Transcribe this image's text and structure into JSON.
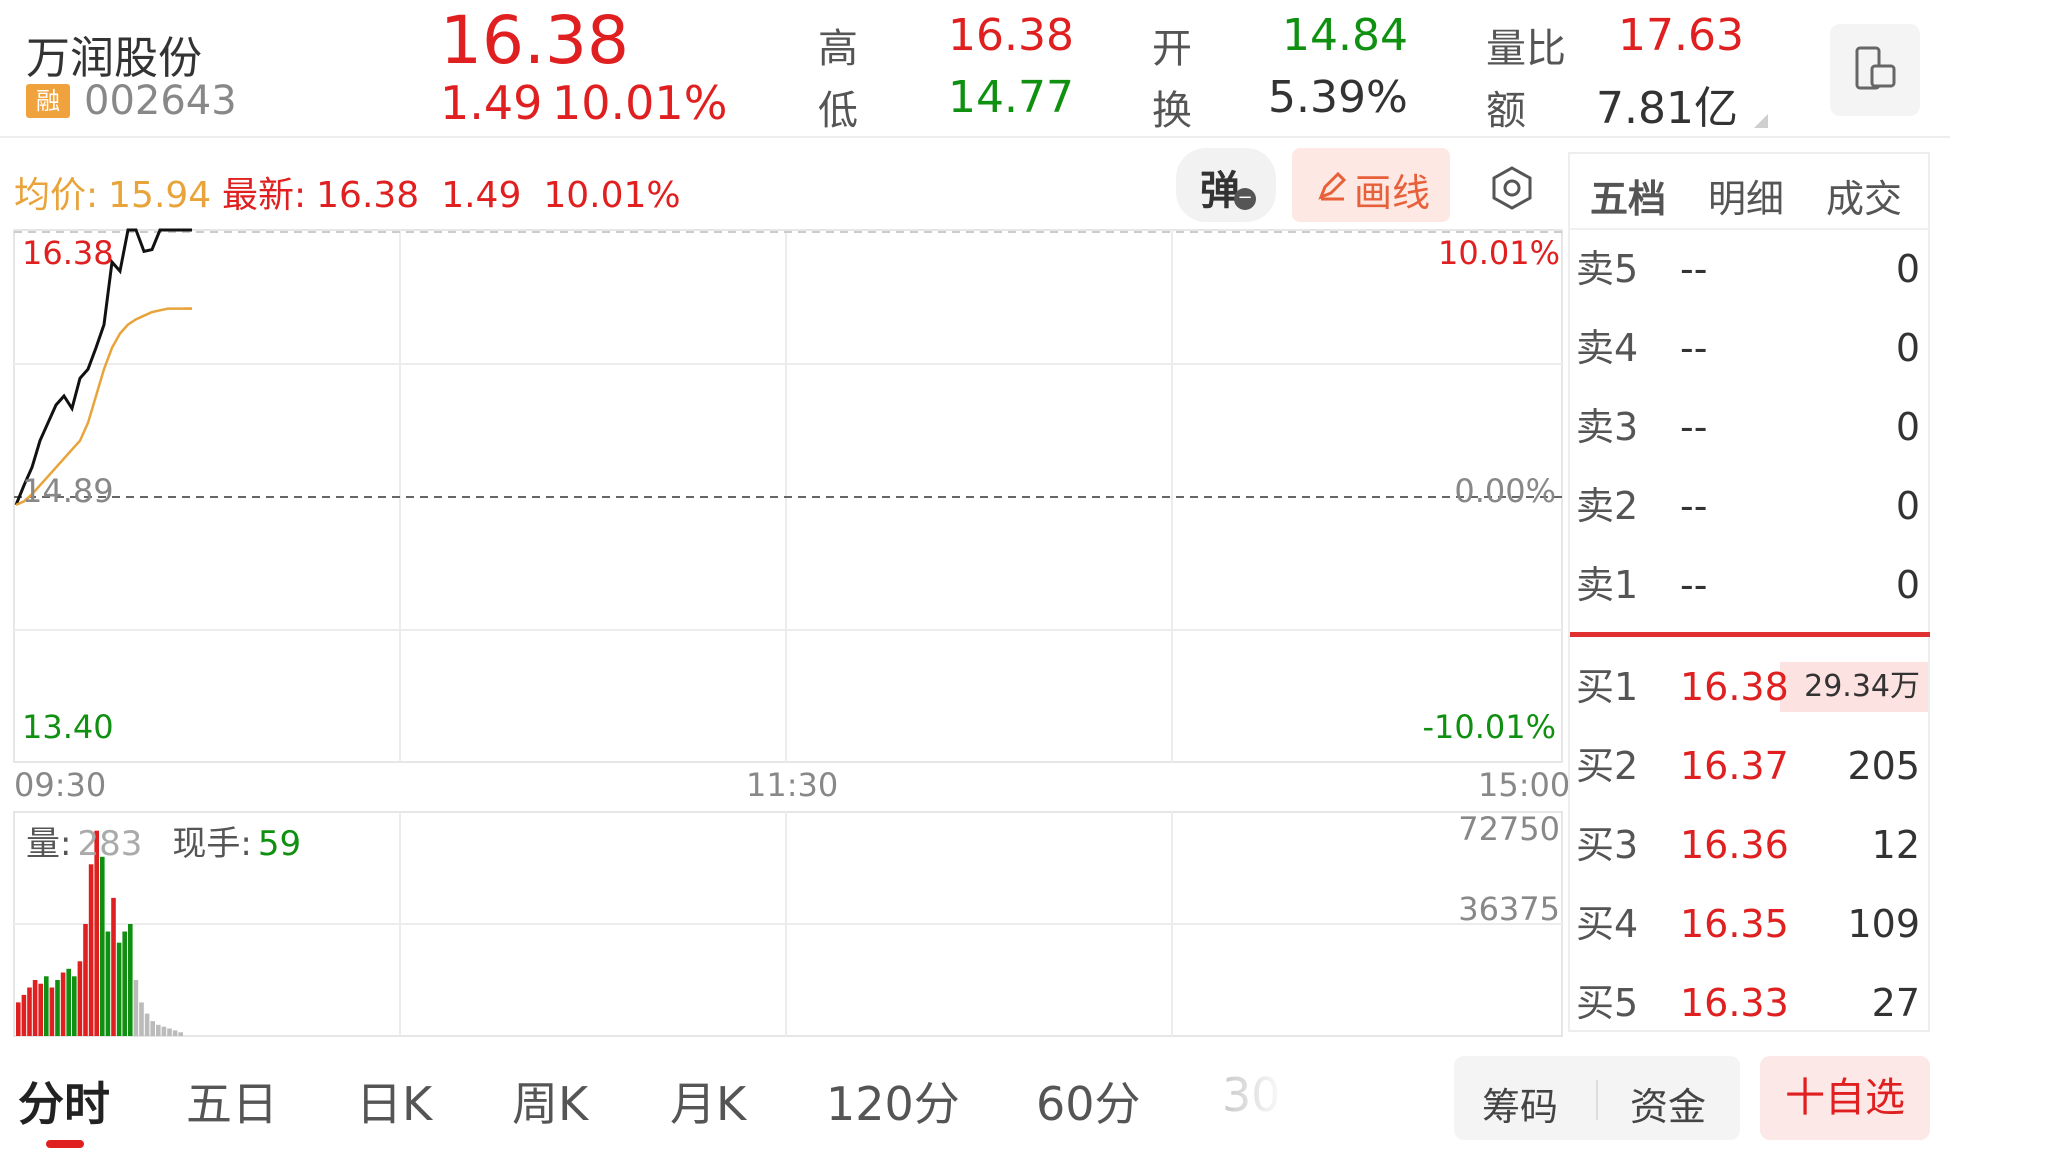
{
  "header": {
    "stock_name": "万润股份",
    "badge": "融",
    "code": "002643",
    "price": "16.38",
    "change": "1.49",
    "change_pct": "10.01%",
    "high_label": "高",
    "high": "16.38",
    "low_label": "低",
    "low": "14.77",
    "open_label": "开",
    "open": "14.84",
    "turnover_label": "换",
    "turnover": "5.39%",
    "vol_ratio_label": "量比",
    "vol_ratio": "17.63",
    "amount_label": "额",
    "amount": "7.81亿",
    "device_icon": "phone-landscape-icon"
  },
  "status_bar": {
    "avg_label": "均价:",
    "avg_value": "15.94",
    "latest_label": "最新:",
    "latest_value": "16.38",
    "latest_change": "1.49",
    "latest_pct": "10.01%",
    "bullet_button": "弹",
    "draw_button": "画线",
    "settings_icon": "gear-icon"
  },
  "chart": {
    "price_top": "16.38",
    "price_mid": "14.89",
    "price_bottom": "13.40",
    "pct_top": "10.01%",
    "pct_mid": "0.00%",
    "pct_bottom": "-10.01%",
    "time_start": "09:30",
    "time_mid": "11:30",
    "time_end": "15:00",
    "vol_label": "量:",
    "vol_value": "283",
    "current_label": "现手:",
    "current_value": "59",
    "vol_top": "72750",
    "vol_mid": "36375"
  },
  "chart_data": {
    "type": "line",
    "title": "",
    "ylim": [
      13.4,
      16.38
    ],
    "series": [
      {
        "values": [
          14.84,
          14.95,
          15.05,
          15.2,
          15.3,
          15.4,
          15.45,
          15.38,
          15.55,
          15.6,
          15.72,
          15.85,
          16.2,
          16.15,
          16.38,
          16.38,
          16.26,
          16.27,
          16.38,
          16.38,
          16.38,
          16.38,
          16.38
        ]
      },
      {
        "values": [
          14.84,
          14.86,
          14.9,
          14.95,
          15.0,
          15.05,
          15.1,
          15.15,
          15.2,
          15.3,
          15.45,
          15.6,
          15.72,
          15.8,
          15.85,
          15.88,
          15.9,
          15.92,
          15.93,
          15.94,
          15.94,
          15.94,
          15.94
        ]
      }
    ],
    "volume": [
      18,
      22,
      26,
      30,
      28,
      32,
      26,
      30,
      34,
      36,
      32,
      40,
      60,
      92,
      110,
      96,
      56,
      74,
      50,
      56,
      60,
      30,
      18,
      12,
      8,
      6,
      5,
      4,
      3,
      2
    ],
    "volume_colors": [
      "r",
      "r",
      "r",
      "r",
      "r",
      "g",
      "r",
      "g",
      "r",
      "g",
      "g",
      "r",
      "r",
      "r",
      "r",
      "g",
      "g",
      "r",
      "g",
      "g",
      "g",
      "x",
      "x",
      "x",
      "x",
      "x",
      "x",
      "x",
      "x",
      "x"
    ]
  },
  "panel": {
    "tabs": [
      "五档",
      "明细",
      "成交"
    ],
    "sells": [
      {
        "label": "卖5",
        "price": "--",
        "vol": "0"
      },
      {
        "label": "卖4",
        "price": "--",
        "vol": "0"
      },
      {
        "label": "卖3",
        "price": "--",
        "vol": "0"
      },
      {
        "label": "卖2",
        "price": "--",
        "vol": "0"
      },
      {
        "label": "卖1",
        "price": "--",
        "vol": "0"
      }
    ],
    "buys": [
      {
        "label": "买1",
        "price": "16.38",
        "vol": "29.34万"
      },
      {
        "label": "买2",
        "price": "16.37",
        "vol": "205"
      },
      {
        "label": "买3",
        "price": "16.36",
        "vol": "12"
      },
      {
        "label": "买4",
        "price": "16.35",
        "vol": "109"
      },
      {
        "label": "买5",
        "price": "16.33",
        "vol": "27"
      }
    ]
  },
  "bottom": {
    "tabs": [
      "分时",
      "五日",
      "日K",
      "周K",
      "月K",
      "120分",
      "60分",
      "30"
    ],
    "chips": "筹码",
    "funds": "资金",
    "watchlist": "十自选"
  }
}
